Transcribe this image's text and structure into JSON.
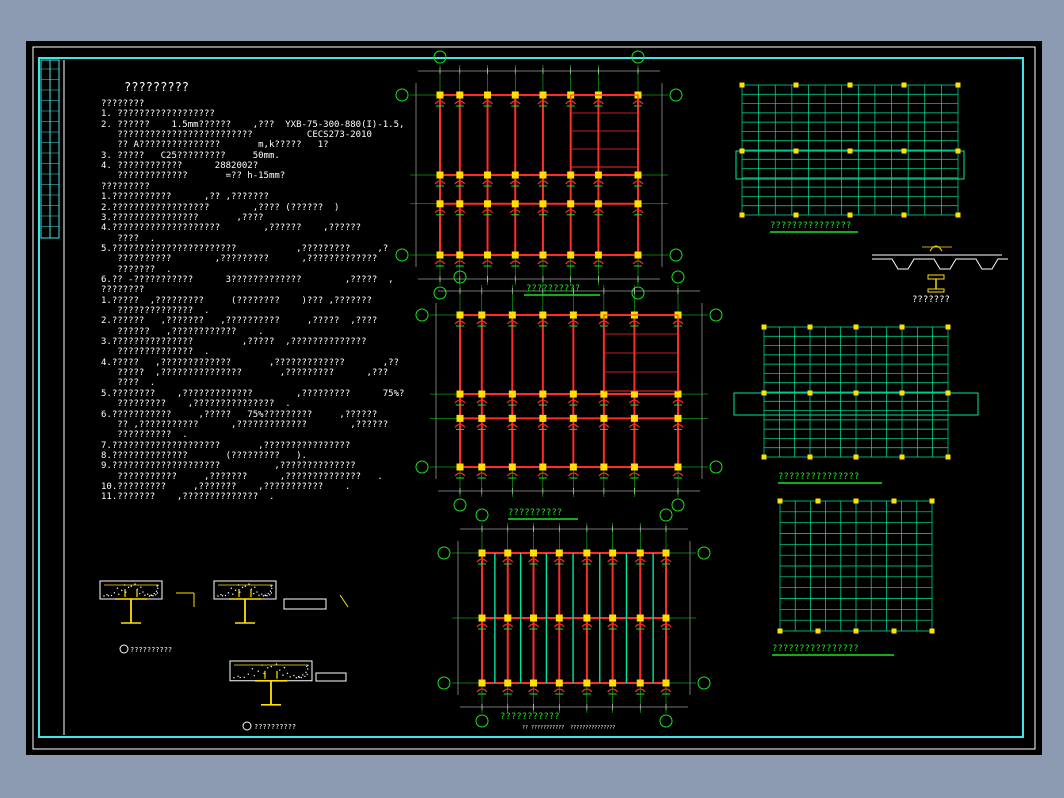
{
  "notes": {
    "title": "?????????",
    "lines": [
      "????????",
      "1. ??????????????????",
      "2. ??????    1.5mm??????    ,???  YXB-75-300-880(I)-1.5,",
      "   ?????????????????????????          CECS273-2010",
      "   ?? A???????????????       m,k?????   1?",
      "3. ?????   C25?????????     50mm.",
      "4. ????????????      2882002?",
      "   ?????????????       =?? h-15mm?",
      "?????????",
      "1.???????????      ,?? ,???????",
      "2.??????????????????        ,???? (??????  )",
      "3.????????????????       ,????",
      "4.????????????????????        ,??????    ,??????",
      "   ????  .",
      "5.???????????????????????           ,?????????     ,?",
      "   ??????????        ,?????????      ,?????????????",
      "   ???????  .",
      "6.?? -???????????      3?????????????        ,?????  ,",
      "????????",
      "1.?????  ,?????????     (????????    )??? ,???????",
      "   ??????????????  .",
      "2.??????   ,???????   ,??????????     ,?????  ,????",
      "   ??????   ,????????????    .",
      "3.???????????????         ,?????  ,??????????????",
      "   ??????????????  .",
      "4.?????   ,?????????????       ,?????????????       ,??",
      "   ?????  ,???????????????       ,?????????      ,???",
      "   ????  .",
      "5.????????    ,?????????????        ,?????????      75%?",
      "   ?????????    ,???????????????  .",
      "6.???????????     ,?????   75%?????????     ,??????",
      "   ?? ,???????????      ,?????????????        ,??????",
      "   ??????????  .",
      "7.????????????????????       ,????????????????",
      "8.??????????????       (?????????   ).",
      "9.????????????????????          ,??????????????",
      "   ???????????     ,???????      ,??????????????   .",
      "10.?????????     ,???????    ,???????????    .",
      "11.???????    ,??????????????  ."
    ],
    "detail_captions": [
      "??????????",
      "??????????"
    ]
  },
  "drawings": {
    "plan_captions": [
      "??????????",
      "??????????",
      "???????????"
    ],
    "plan_note": "?? ???????????  ???????????????",
    "layout_captions": [
      "???????????????",
      "???????????????",
      "????????????????"
    ],
    "section_caption": "???????"
  },
  "colors": {
    "frame": "#3ee6e6",
    "beam": "#ff2a2a",
    "grid": "#19e619",
    "column": "#ffe100",
    "slab": "#00e6a0",
    "dim": "#e6e6e6"
  }
}
